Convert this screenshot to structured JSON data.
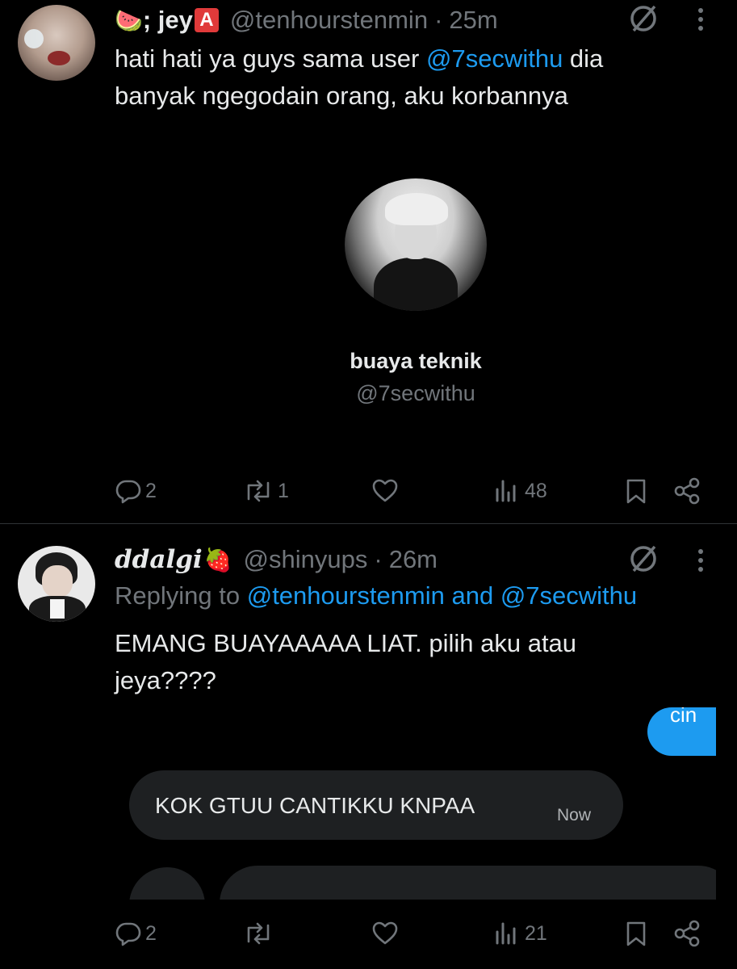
{
  "colors": {
    "background": "#000000",
    "text": "#e7e9ea",
    "muted": "#71767b",
    "link": "#1d9bf0",
    "divider": "#2f3336",
    "bubble": "#1e2022",
    "bubble_sent": "#1d9bf0"
  },
  "tweet1": {
    "emoji_prefix": "🍉",
    "display_name": "; jey",
    "emoji_suffix": "🅰️",
    "handle": "@tenhourstenmin",
    "sep": "·",
    "time": "25m",
    "text_before": "hati hati ya guys sama user ",
    "mention": "@7secwithu",
    "text_after": " dia banyak ngegodain orang, aku korbannya",
    "card": {
      "name": "buaya teknik",
      "handle": "@7secwithu"
    },
    "stats": {
      "replies": "2",
      "retweets": "1",
      "likes": "",
      "views": "48"
    }
  },
  "tweet2": {
    "display_name": "ddalgi",
    "emoji_suffix": "🍓",
    "handle": "@shinyups",
    "sep": "·",
    "time": "26m",
    "replying_prefix": "Replying to ",
    "replying_user1": "@tenhourstenmin",
    "replying_and": " and ",
    "replying_user2": "@7secwithu",
    "text": "EMANG BUAYAAAAA LIAT. pilih aku atau jeya????",
    "chat": {
      "sent_partial": "cin",
      "received": "KOK GTUU CANTIKKU KNPAA",
      "received_time": "Now"
    },
    "stats": {
      "replies": "2",
      "retweets": "",
      "likes": "",
      "views": "21"
    }
  },
  "icons": [
    "slash-circle-icon",
    "more-vertical-icon",
    "reply-icon",
    "retweet-icon",
    "like-icon",
    "views-icon",
    "bookmark-icon",
    "share-icon"
  ]
}
